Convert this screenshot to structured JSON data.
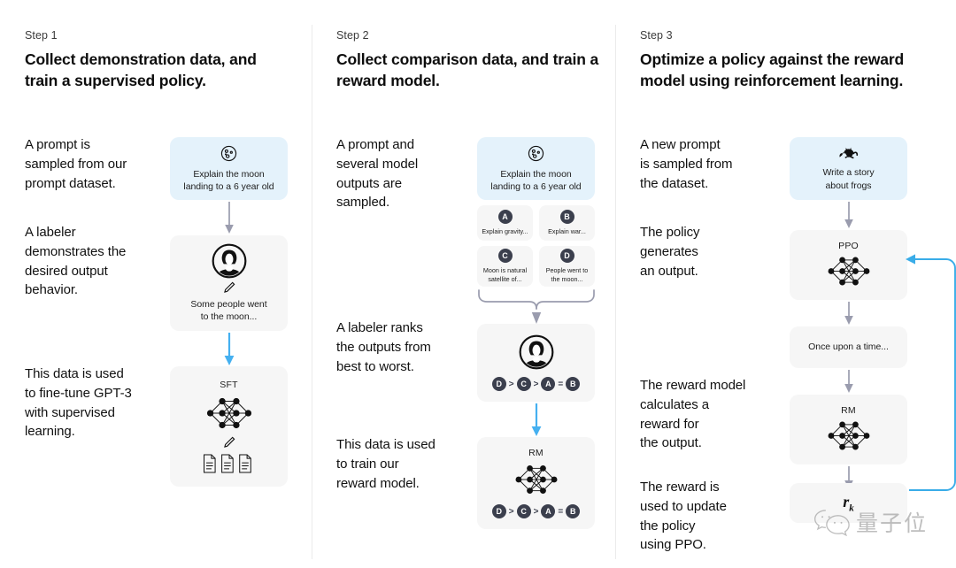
{
  "columns": [
    {
      "step_label": "Step 1",
      "step_title": "Collect demonstration data,\nand train a supervised policy.",
      "paragraphs": [
        "A prompt is\nsampled from our\nprompt dataset.",
        "A labeler\ndemonstrates the\ndesired output\nbehavior.",
        "This data is used\nto fine-tune GPT-3\nwith supervised\nlearning."
      ],
      "cards": [
        {
          "name": "prompt-card",
          "icon": "moon-icon",
          "text": "Explain the moon\nlanding to a 6 year old"
        },
        {
          "name": "labeler-demo-card",
          "icon": "labeler-icon",
          "text": "Some people went\nto the moon..."
        },
        {
          "name": "sft-model-card",
          "icon": "neural-network-icon",
          "label": "SFT",
          "text": ""
        }
      ]
    },
    {
      "step_label": "Step 2",
      "step_title": "Collect comparison data,\nand train a reward model.",
      "paragraphs": [
        "A prompt and\nseveral model\noutputs are\nsampled.",
        "A labeler ranks\nthe outputs from\nbest to worst.",
        "This data is used\nto train our\nreward model."
      ],
      "prompt_card": {
        "icon": "moon-icon",
        "text": "Explain the moon\nlanding to a 6 year old"
      },
      "outputs": [
        {
          "badge": "A",
          "text": "Explain gravity..."
        },
        {
          "badge": "B",
          "text": "Explain war..."
        },
        {
          "badge": "C",
          "text": "Moon is natural\nsatellite of..."
        },
        {
          "badge": "D",
          "text": "People went to\nthe moon..."
        }
      ],
      "ranking": [
        "D",
        ">",
        "C",
        ">",
        "A",
        "=",
        "B"
      ],
      "rm_label": "RM"
    },
    {
      "step_label": "Step 3",
      "step_title": "Optimize a policy against\nthe reward model using\nreinforcement learning.",
      "paragraphs": [
        "A new prompt\nis sampled from\nthe dataset.",
        "The policy\ngenerates\nan output.",
        "The reward model\ncalculates a\nreward for\nthe output.",
        "The reward is\nused to update\nthe policy\nusing PPO."
      ],
      "cards": [
        {
          "name": "new-prompt-card",
          "icon": "frog-icon",
          "text": "Write a story\nabout frogs"
        },
        {
          "name": "ppo-model-card",
          "icon": "neural-network-icon",
          "label": "PPO"
        },
        {
          "name": "generated-output-card",
          "text": "Once upon a time..."
        },
        {
          "name": "rm-model-card",
          "icon": "neural-network-icon",
          "label": "RM"
        },
        {
          "name": "reward-value-card",
          "value": "r",
          "subscript": "k"
        }
      ]
    }
  ],
  "watermark": {
    "text": "量子位",
    "icon": "wechat-icon"
  },
  "colors": {
    "blue_card": "#e4f2fb",
    "gray_card": "#f6f6f6",
    "blue_arrow": "#45b0f0",
    "gray_arrow": "#9a9cae",
    "badge": "#3b3f4d",
    "divider": "#ebebeb"
  }
}
